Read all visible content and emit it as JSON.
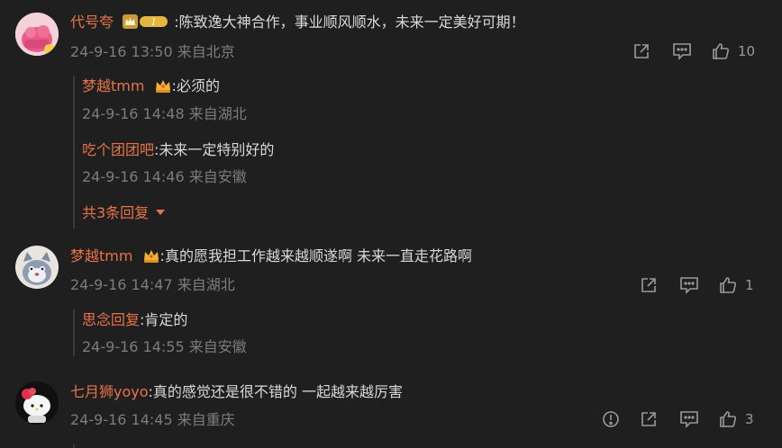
{
  "comments": [
    {
      "name": "代号夸",
      "colon": ":",
      "text": "陈致逸大神合作，事业顺风顺水，未来一定美好可期！",
      "time": "24-9-16 13:50",
      "location": "来自北京",
      "likes": "10",
      "badge": "vip-level-1",
      "replies": [
        {
          "name": "梦越tmm",
          "colon": ":",
          "text": "必须的",
          "time": "24-9-16 14:48",
          "location": "来自湖北"
        },
        {
          "name": "吃个团团吧",
          "colon": ":",
          "text": "未来一定特别好的",
          "time": "24-9-16 14:46",
          "location": "来自安徽"
        }
      ],
      "more_replies": "共3条回复"
    },
    {
      "name": "梦越tmm",
      "colon": ":",
      "text": "真的愿我担工作越来越顺遂啊  未来一直走花路啊",
      "time": "24-9-16 14:47",
      "location": "来自湖北",
      "likes": "1",
      "replies": [
        {
          "name": "思念回复",
          "colon": ":",
          "text": "肯定的",
          "time": "24-9-16 14:55",
          "location": "来自安徽"
        }
      ]
    },
    {
      "name": "七月狮yoyo",
      "colon": ":",
      "text": "真的感觉还是很不错的 一起越来越厉害",
      "time": "24-9-16 14:45",
      "location": "来自重庆",
      "likes": "3"
    }
  ],
  "colors": {
    "background": "#1f1f1f",
    "username": "#e8734a",
    "meta": "#7c7c7c",
    "icon": "#9a9a9a"
  }
}
